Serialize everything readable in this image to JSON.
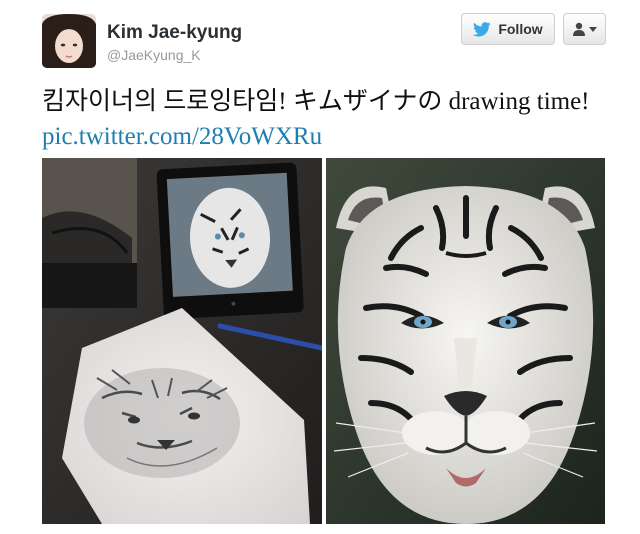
{
  "user": {
    "name": "Kim Jae-kyung",
    "handle": "@JaeKyung_K"
  },
  "actions": {
    "follow_label": "Follow",
    "bird_icon": "twitter-bird-icon",
    "user_icon": "user-icon"
  },
  "tweet": {
    "text_before_link": "킴자이너의 드로잉타임! キムザイナの drawing time! ",
    "link_text": "pic.twitter.com/28VoWXRu"
  },
  "colors": {
    "link": "#1d7fb0",
    "twitter_blue": "#3ba9e8",
    "name": "#292f33",
    "handle": "#999999"
  }
}
